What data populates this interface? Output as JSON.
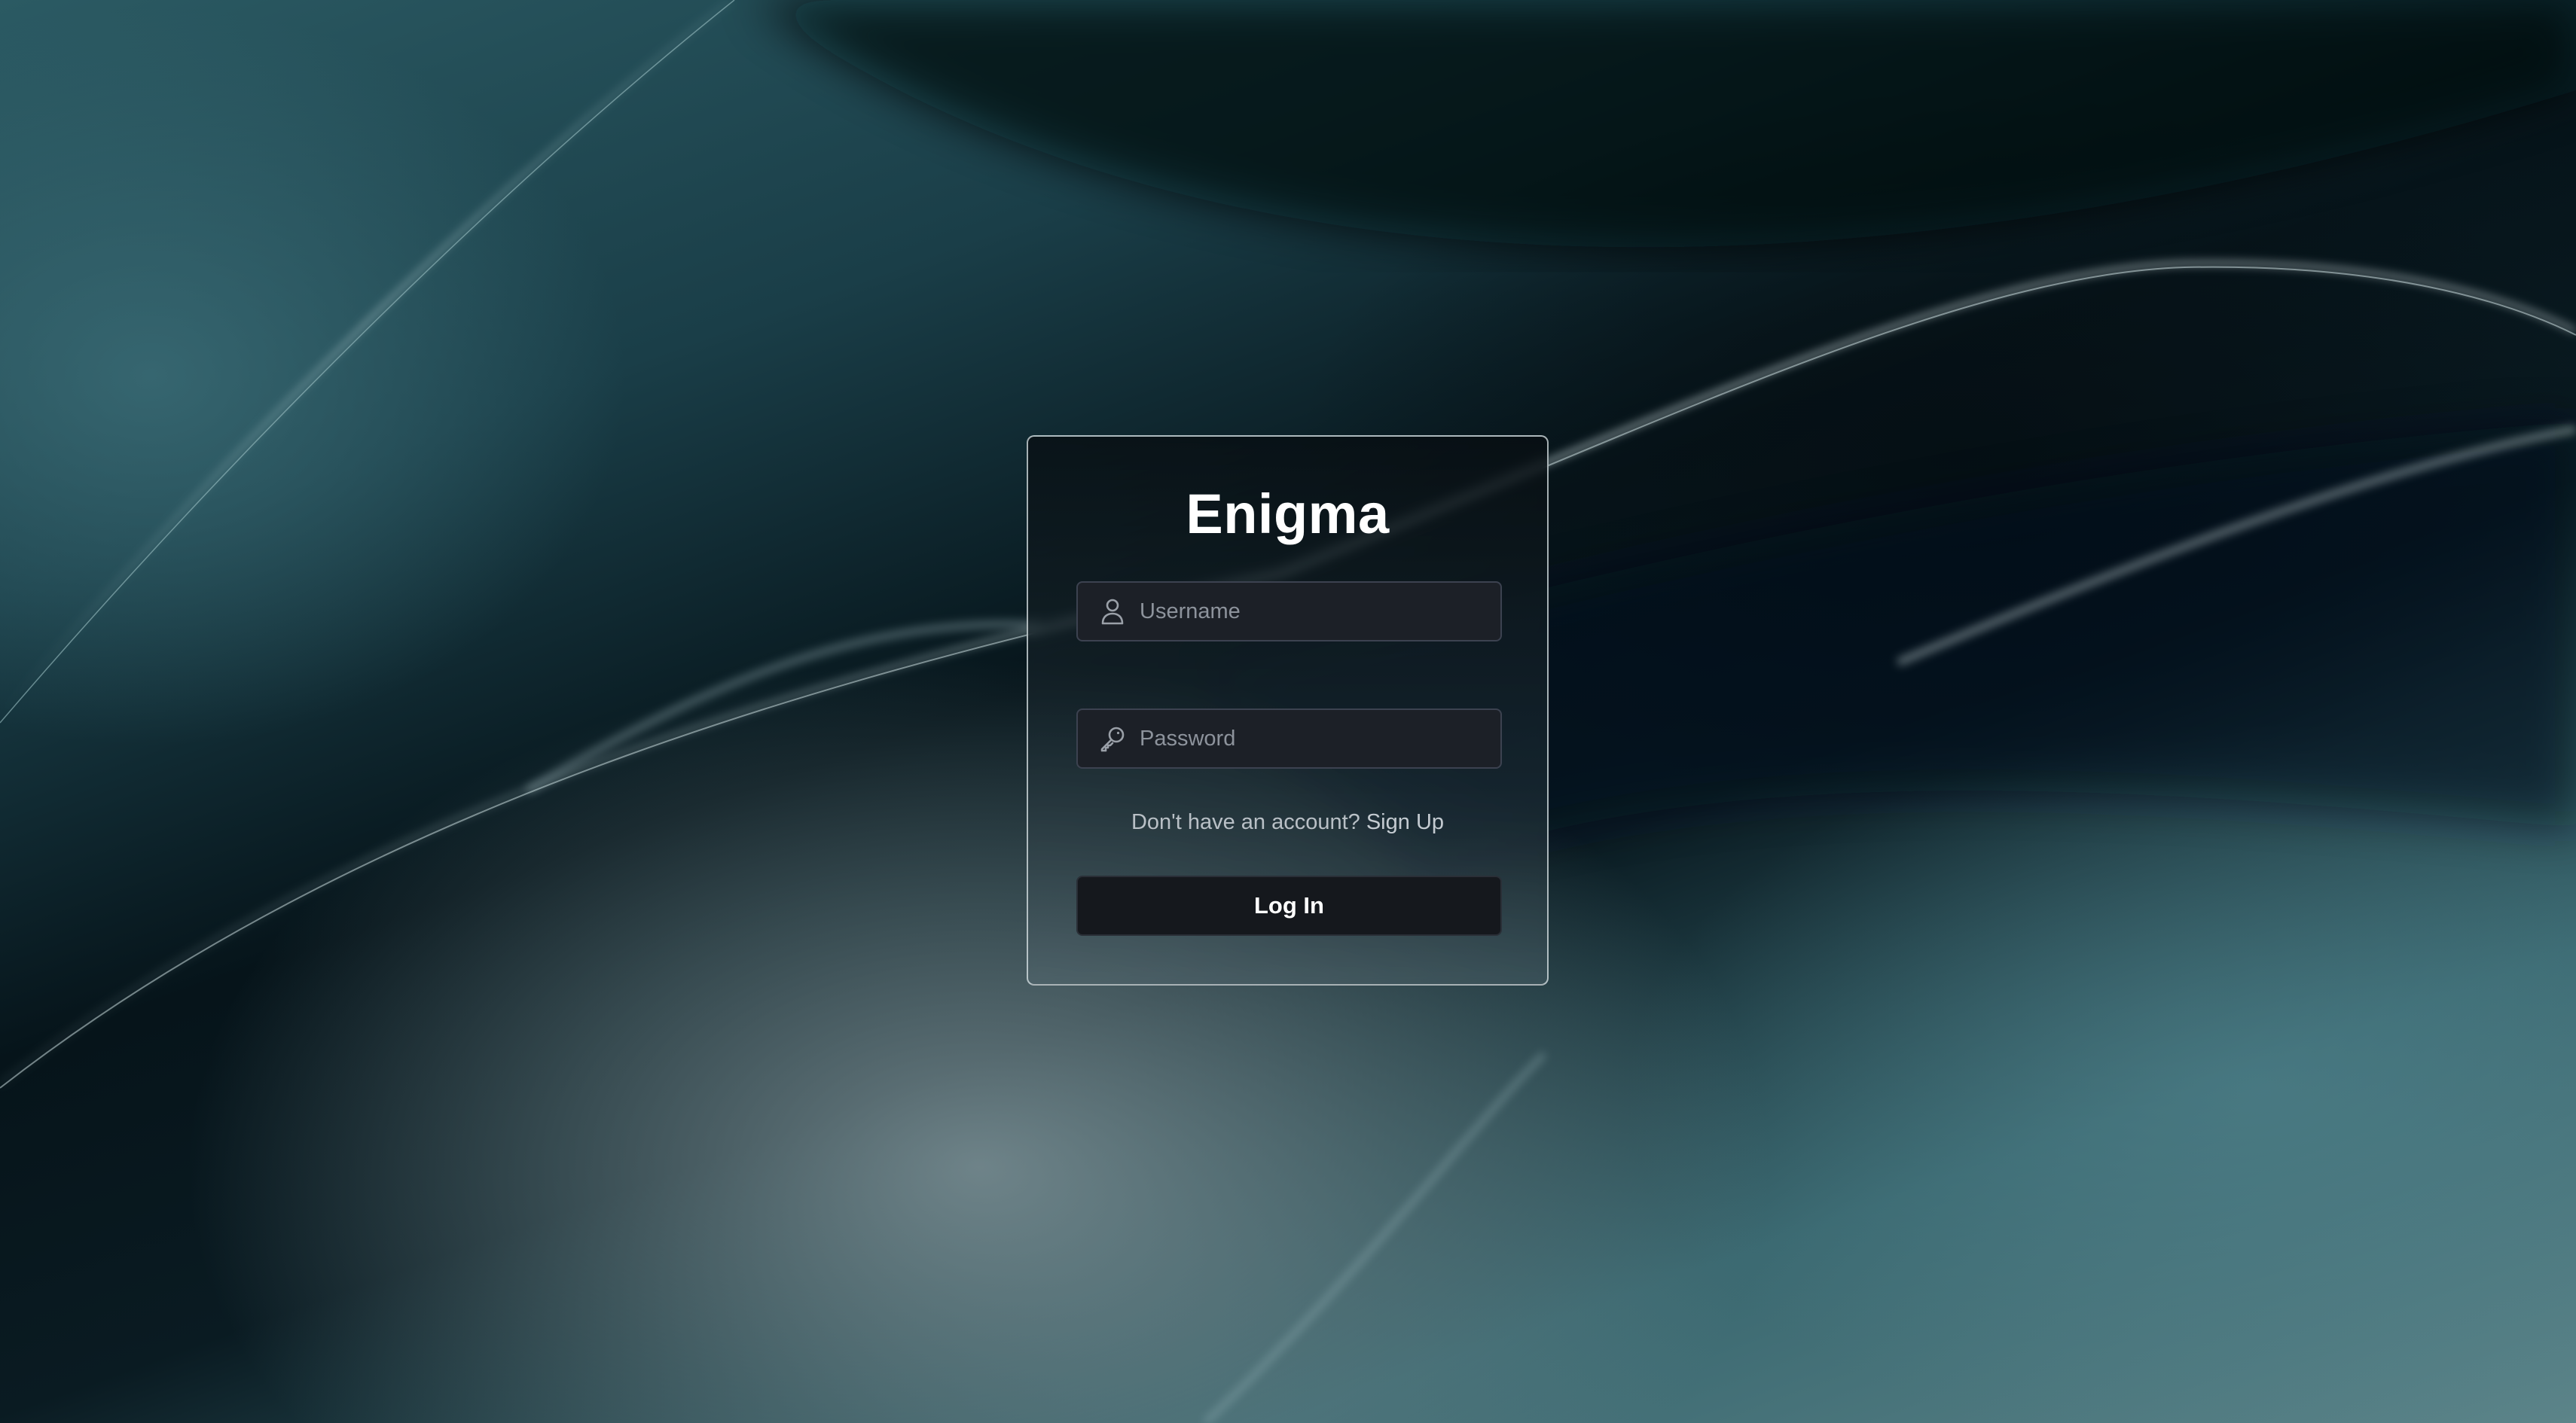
{
  "app": {
    "title": "Enigma"
  },
  "form": {
    "username": {
      "value": "",
      "placeholder": "Username",
      "icon": "user-icon"
    },
    "password": {
      "value": "",
      "placeholder": "Password",
      "icon": "key-icon"
    },
    "signup_prompt": "Don't have an account?",
    "signup_link": "Sign Up",
    "submit_label": "Log In"
  },
  "colors": {
    "card_border": "#dce6e8",
    "input_bg": "#1c2027",
    "button_bg": "#15181d",
    "title": "#ffffff",
    "muted_text": "#b9c0c6"
  }
}
